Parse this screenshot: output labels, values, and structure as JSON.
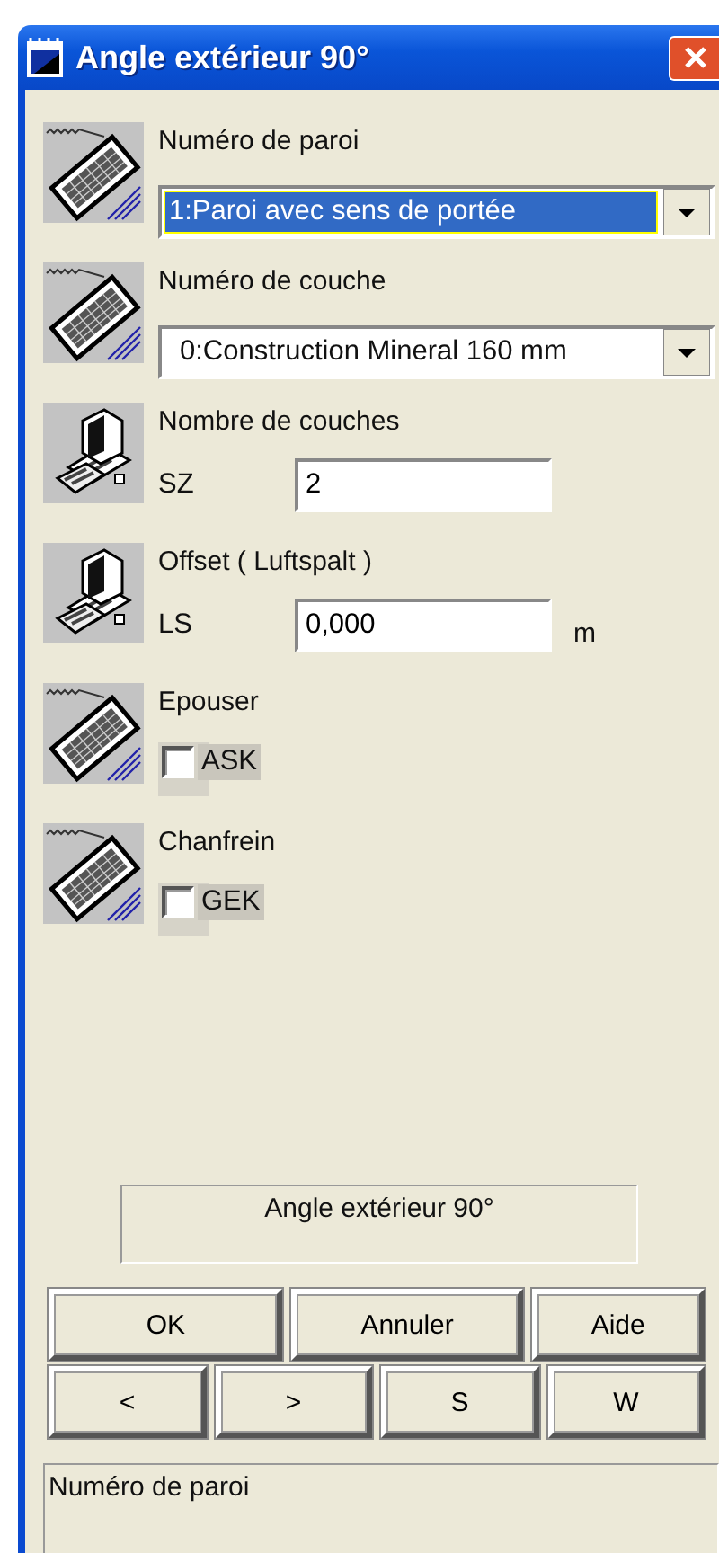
{
  "window": {
    "title": "Angle extérieur 90°"
  },
  "sections": [
    {
      "kind": "dropdown",
      "label": "Numéro de paroi",
      "value": "1:Paroi avec sens de portée",
      "focused": true
    },
    {
      "kind": "dropdown",
      "label": "Numéro de couche",
      "value": "0:Construction Mineral 160 mm",
      "focused": false
    },
    {
      "kind": "input",
      "label": "Nombre de couches",
      "field_label": "SZ",
      "value": "2"
    },
    {
      "kind": "input",
      "label": "Offset ( Luftspalt )",
      "field_label": "LS",
      "value": "0,000",
      "unit": "m"
    },
    {
      "kind": "checkbox",
      "label": "Epouser",
      "checkbox_label": "ASK",
      "checked": false
    },
    {
      "kind": "checkbox",
      "label": "Chanfrein",
      "checkbox_label": "GEK",
      "checked": false
    }
  ],
  "info_box": "Angle extérieur 90°",
  "button_rows": [
    {
      "buttons": [
        "OK",
        "Annuler",
        "Aide"
      ]
    },
    {
      "buttons": [
        "<",
        ">",
        "S",
        "W"
      ]
    }
  ],
  "status_text": "Numéro de paroi"
}
